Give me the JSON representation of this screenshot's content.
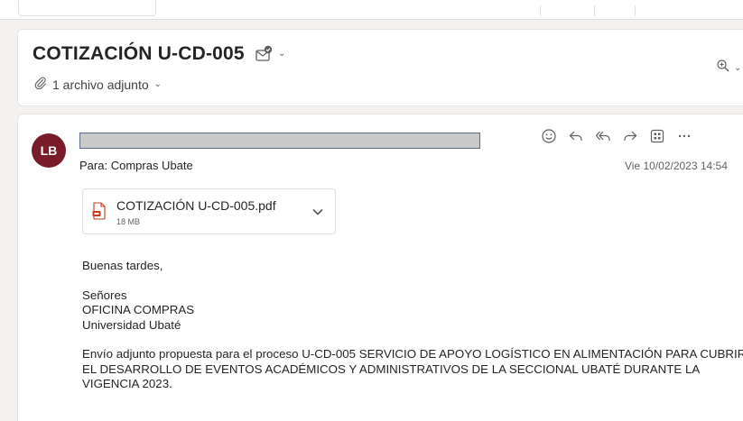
{
  "subject": {
    "title": "COTIZACIÓN U-CD-005",
    "attachments_summary": "1 archivo adjunto"
  },
  "message": {
    "avatar_initials": "LB",
    "to_label": "Para:",
    "to_value": "Compras Ubate",
    "datetime": "Vie 10/02/2023 14:54",
    "attachment": {
      "name": "COTIZACIÓN U-CD-005.pdf",
      "size": "18 MB"
    },
    "body": {
      "greeting": "Buenas tardes,",
      "line_1": "Señores",
      "line_2": "OFICINA COMPRAS",
      "line_3": "Universidad Ubaté",
      "para_1": "Envío adjunto propuesta para el proceso U-CD-005 SERVICIO DE APOYO LOGÍSTICO EN ALIMENTACIÓN PARA CUBRIR EL DESARROLLO DE EVENTOS ACADÉMICOS Y ADMINISTRATIVOS DE LA SECCIONAL UBATÉ DURANTE LA VIGENCIA 2023."
    }
  },
  "icons": {
    "subject": "envelope-check-icon",
    "attach": "paperclip-icon",
    "zoom": "zoom-in-icon",
    "actions": [
      "emoji-icon",
      "reply-icon",
      "reply-all-icon",
      "forward-icon",
      "apps-icon",
      "more-icon"
    ],
    "file": "pdf-icon"
  },
  "colors": {
    "avatar": "#7a1b2a",
    "pdf": "#c43e1c",
    "sender_border": "#5a6e8c",
    "sender_fill": "#c9c9c9"
  }
}
